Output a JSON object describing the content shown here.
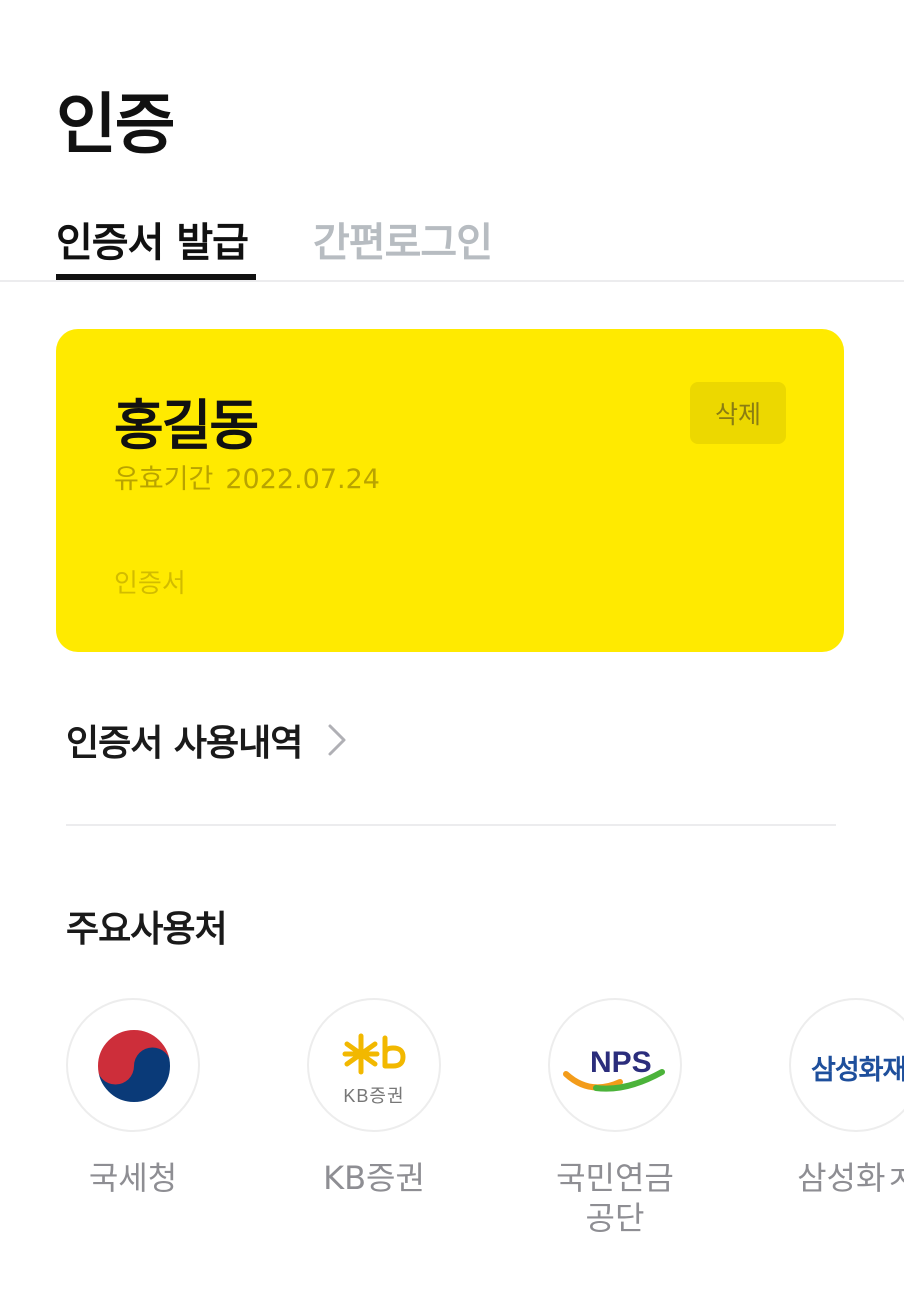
{
  "header": {
    "title": "인증"
  },
  "tabs": [
    {
      "label": "인증서 발급",
      "active": true
    },
    {
      "label": "간편로그인",
      "active": false
    }
  ],
  "certificate": {
    "name": "홍길동",
    "validity_label": "유효기간",
    "validity_date": "2022.07.24",
    "delete_label": "삭제",
    "card_label": "인증서",
    "card_color": "#ffea00"
  },
  "history": {
    "label": "인증서 사용내역",
    "icon": "chevron-right-icon"
  },
  "partners": {
    "title": "주요사용처",
    "items": [
      {
        "name": "국세청",
        "logo": "taegeuk-icon"
      },
      {
        "name": "KB증권",
        "logo": "kb-logo",
        "logo_text": "KB증권"
      },
      {
        "name": "국민연금\n공단",
        "name_line1": "국민연금",
        "name_line2": "공단",
        "logo": "nps-logo",
        "logo_text": "NPS"
      },
      {
        "name": "삼성화재",
        "logo": "samsung-logo",
        "logo_text": "삼성화재",
        "label_visible": "삼성화ㅈ"
      }
    ]
  },
  "colors": {
    "text_primary": "#111111",
    "tab_inactive": "#b7bcc1",
    "label_gray": "#8e8e93",
    "card_yellow": "#ffea00"
  }
}
